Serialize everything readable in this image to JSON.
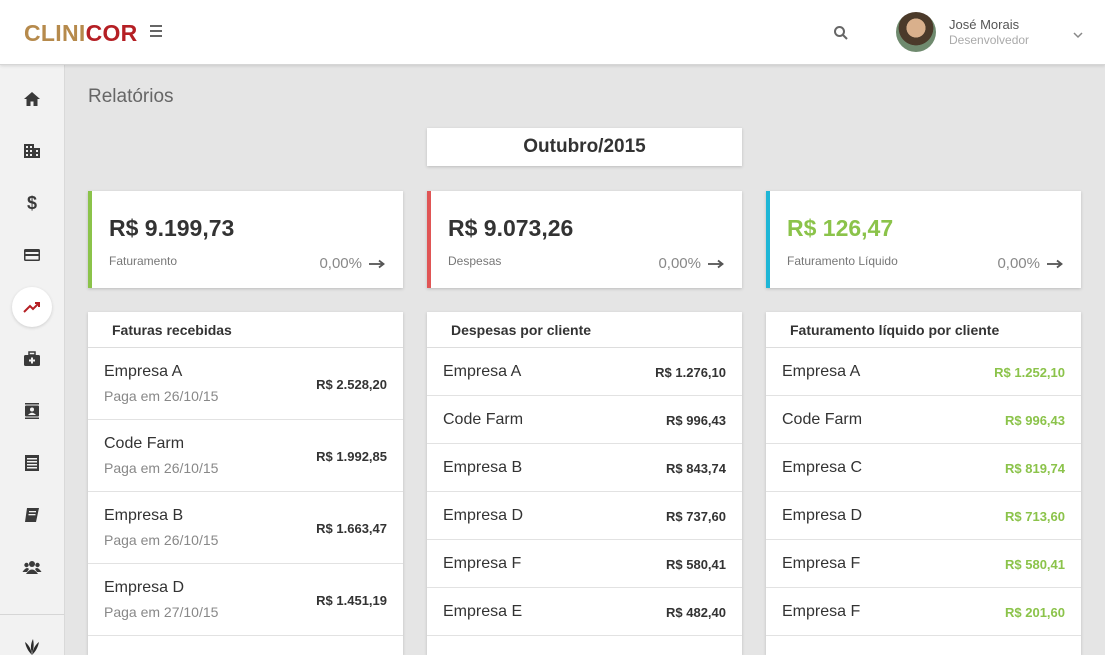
{
  "brand": {
    "logo_part1": "CLINI",
    "logo_part2": "COR"
  },
  "user": {
    "name": "José Morais",
    "role": "Desenvolvedor"
  },
  "sidebar": {
    "items": [
      {
        "icon": "home-icon"
      },
      {
        "icon": "building-icon"
      },
      {
        "icon": "dollar-icon"
      },
      {
        "icon": "credit-card-icon"
      },
      {
        "icon": "trending-up-icon",
        "active": true
      },
      {
        "icon": "medical-kit-icon"
      },
      {
        "icon": "contacts-icon"
      },
      {
        "icon": "list-document-icon"
      },
      {
        "icon": "book-icon"
      },
      {
        "icon": "group-icon"
      },
      {
        "icon": "plant-icon"
      }
    ]
  },
  "page": {
    "title": "Relatórios",
    "period": "Outubro/2015"
  },
  "colors": {
    "revenue_bar": "#8bc34a",
    "expense_bar": "#e05555",
    "net_bar": "#1eb6d6",
    "positive": "#8bc34a",
    "brand_gold": "#b68a4c",
    "brand_red": "#b51f24"
  },
  "stats": {
    "revenue": {
      "value": "R$ 9.199,73",
      "label": "Faturamento",
      "change": "0,00%"
    },
    "expenses": {
      "value": "R$ 9.073,26",
      "label": "Despesas",
      "change": "0,00%"
    },
    "net": {
      "value": "R$ 126,47",
      "label": "Faturamento Líquido",
      "change": "0,00%"
    }
  },
  "invoices": {
    "title": "Faturas recebidas",
    "rows": [
      {
        "name": "Empresa A",
        "detail": "Paga em 26/10/15",
        "amount": "R$ 2.528,20"
      },
      {
        "name": "Code Farm",
        "detail": "Paga em 26/10/15",
        "amount": "R$ 1.992,85"
      },
      {
        "name": "Empresa B",
        "detail": "Paga em 26/10/15",
        "amount": "R$ 1.663,47"
      },
      {
        "name": "Empresa D",
        "detail": "Paga em 27/10/15",
        "amount": "R$ 1.451,19"
      }
    ]
  },
  "expenses_by_client": {
    "title": "Despesas por cliente",
    "rows": [
      {
        "name": "Empresa A",
        "amount": "R$ 1.276,10"
      },
      {
        "name": "Code Farm",
        "amount": "R$ 996,43"
      },
      {
        "name": "Empresa B",
        "amount": "R$ 843,74"
      },
      {
        "name": "Empresa D",
        "amount": "R$ 737,60"
      },
      {
        "name": "Empresa F",
        "amount": "R$ 580,41"
      },
      {
        "name": "Empresa E",
        "amount": "R$ 482,40"
      }
    ]
  },
  "net_by_client": {
    "title": "Faturamento líquido por cliente",
    "rows": [
      {
        "name": "Empresa A",
        "amount": "R$ 1.252,10"
      },
      {
        "name": "Code Farm",
        "amount": "R$ 996,43"
      },
      {
        "name": "Empresa C",
        "amount": "R$ 819,74"
      },
      {
        "name": "Empresa D",
        "amount": "R$ 713,60"
      },
      {
        "name": "Empresa F",
        "amount": "R$ 580,41"
      },
      {
        "name": "Empresa F",
        "amount": "R$ 201,60"
      }
    ]
  }
}
